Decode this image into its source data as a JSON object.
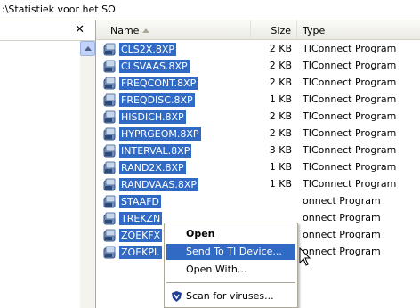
{
  "address": {
    "path": ":\\Statistiek voor het SO"
  },
  "left_pane": {
    "close_label": "✕"
  },
  "columns": {
    "name": "Name",
    "size": "Size",
    "type": "Type"
  },
  "files": [
    {
      "name": "CLS2X.8XP",
      "size": "2 KB",
      "type": "TIConnect Program"
    },
    {
      "name": "CLSVAAS.8XP",
      "size": "2 KB",
      "type": "TIConnect Program"
    },
    {
      "name": "FREQCONT.8XP",
      "size": "2 KB",
      "type": "TIConnect Program"
    },
    {
      "name": "FREQDISC.8XP",
      "size": "1 KB",
      "type": "TIConnect Program"
    },
    {
      "name": "HISDICH.8XP",
      "size": "2 KB",
      "type": "TIConnect Program"
    },
    {
      "name": "HYPRGEOM.8XP",
      "size": "2 KB",
      "type": "TIConnect Program"
    },
    {
      "name": "INTERVAL.8XP",
      "size": "3 KB",
      "type": "TIConnect Program"
    },
    {
      "name": "RAND2X.8XP",
      "size": "1 KB",
      "type": "TIConnect Program"
    },
    {
      "name": "RANDVAAS.8XP",
      "size": "1 KB",
      "type": "TIConnect Program"
    },
    {
      "name": "STAAFD",
      "size": "",
      "type": "onnect Program"
    },
    {
      "name": "TREKZN",
      "size": "",
      "type": "onnect Program"
    },
    {
      "name": "ZOEKFX",
      "size": "",
      "type": "onnect Program"
    },
    {
      "name": "ZOEKPI.",
      "size": "",
      "type": "onnect Program"
    }
  ],
  "context_menu": {
    "open": "Open",
    "send": "Send To TI Device...",
    "open_with": "Open With...",
    "scan": "Scan for viruses..."
  },
  "colors": {
    "selection": "#316ac5",
    "header_border": "#d4d0c8"
  }
}
